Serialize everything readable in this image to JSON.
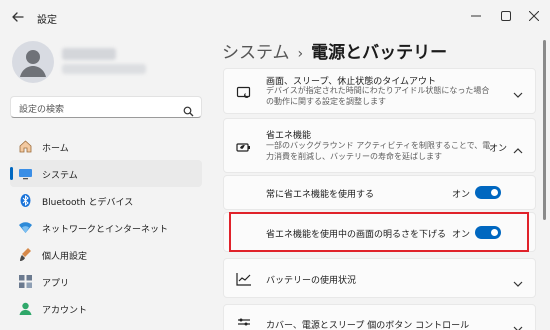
{
  "window": {
    "title": "設定"
  },
  "search": {
    "placeholder": "設定の検索"
  },
  "sidebar": {
    "items": [
      {
        "label": "ホーム",
        "icon": "home-icon",
        "active": false
      },
      {
        "label": "システム",
        "icon": "system-icon",
        "active": true
      },
      {
        "label": "Bluetooth とデバイス",
        "icon": "bluetooth-icon",
        "active": false
      },
      {
        "label": "ネットワークとインターネット",
        "icon": "network-icon",
        "active": false
      },
      {
        "label": "個人用設定",
        "icon": "personalization-icon",
        "active": false
      },
      {
        "label": "アプリ",
        "icon": "apps-icon",
        "active": false
      },
      {
        "label": "アカウント",
        "icon": "account-icon",
        "active": false
      }
    ]
  },
  "breadcrumb": {
    "parent": "システム",
    "separator": "›",
    "current": "電源とバッテリー"
  },
  "main": {
    "screen_sleep": {
      "title": "画面、スリープ、休止状態のタイムアウト",
      "desc": "デバイスが指定された時間にわたりアイドル状態になった場合の動作に関する設定を調整します"
    },
    "energy_saver": {
      "title": "省エネ機能",
      "desc": "一部のバックグラウンド アクティビティを制限することで、電力消費を削減し、バッテリーの寿命を延ばします",
      "state": "オン"
    },
    "always_on": {
      "label": "常に省エネ機能を使用する",
      "state": "オン",
      "on": true
    },
    "lower_brightness": {
      "label": "省エネ機能を使用中の画面の明るさを下げる",
      "state": "オン",
      "on": true
    },
    "battery_usage": {
      "title": "バッテリーの使用状況"
    },
    "lid_buttons": {
      "title": "カバー、電源とスリープ 個のボタン コントロール"
    }
  },
  "colors": {
    "accent": "#0067c0",
    "highlight": "#e0222a"
  }
}
